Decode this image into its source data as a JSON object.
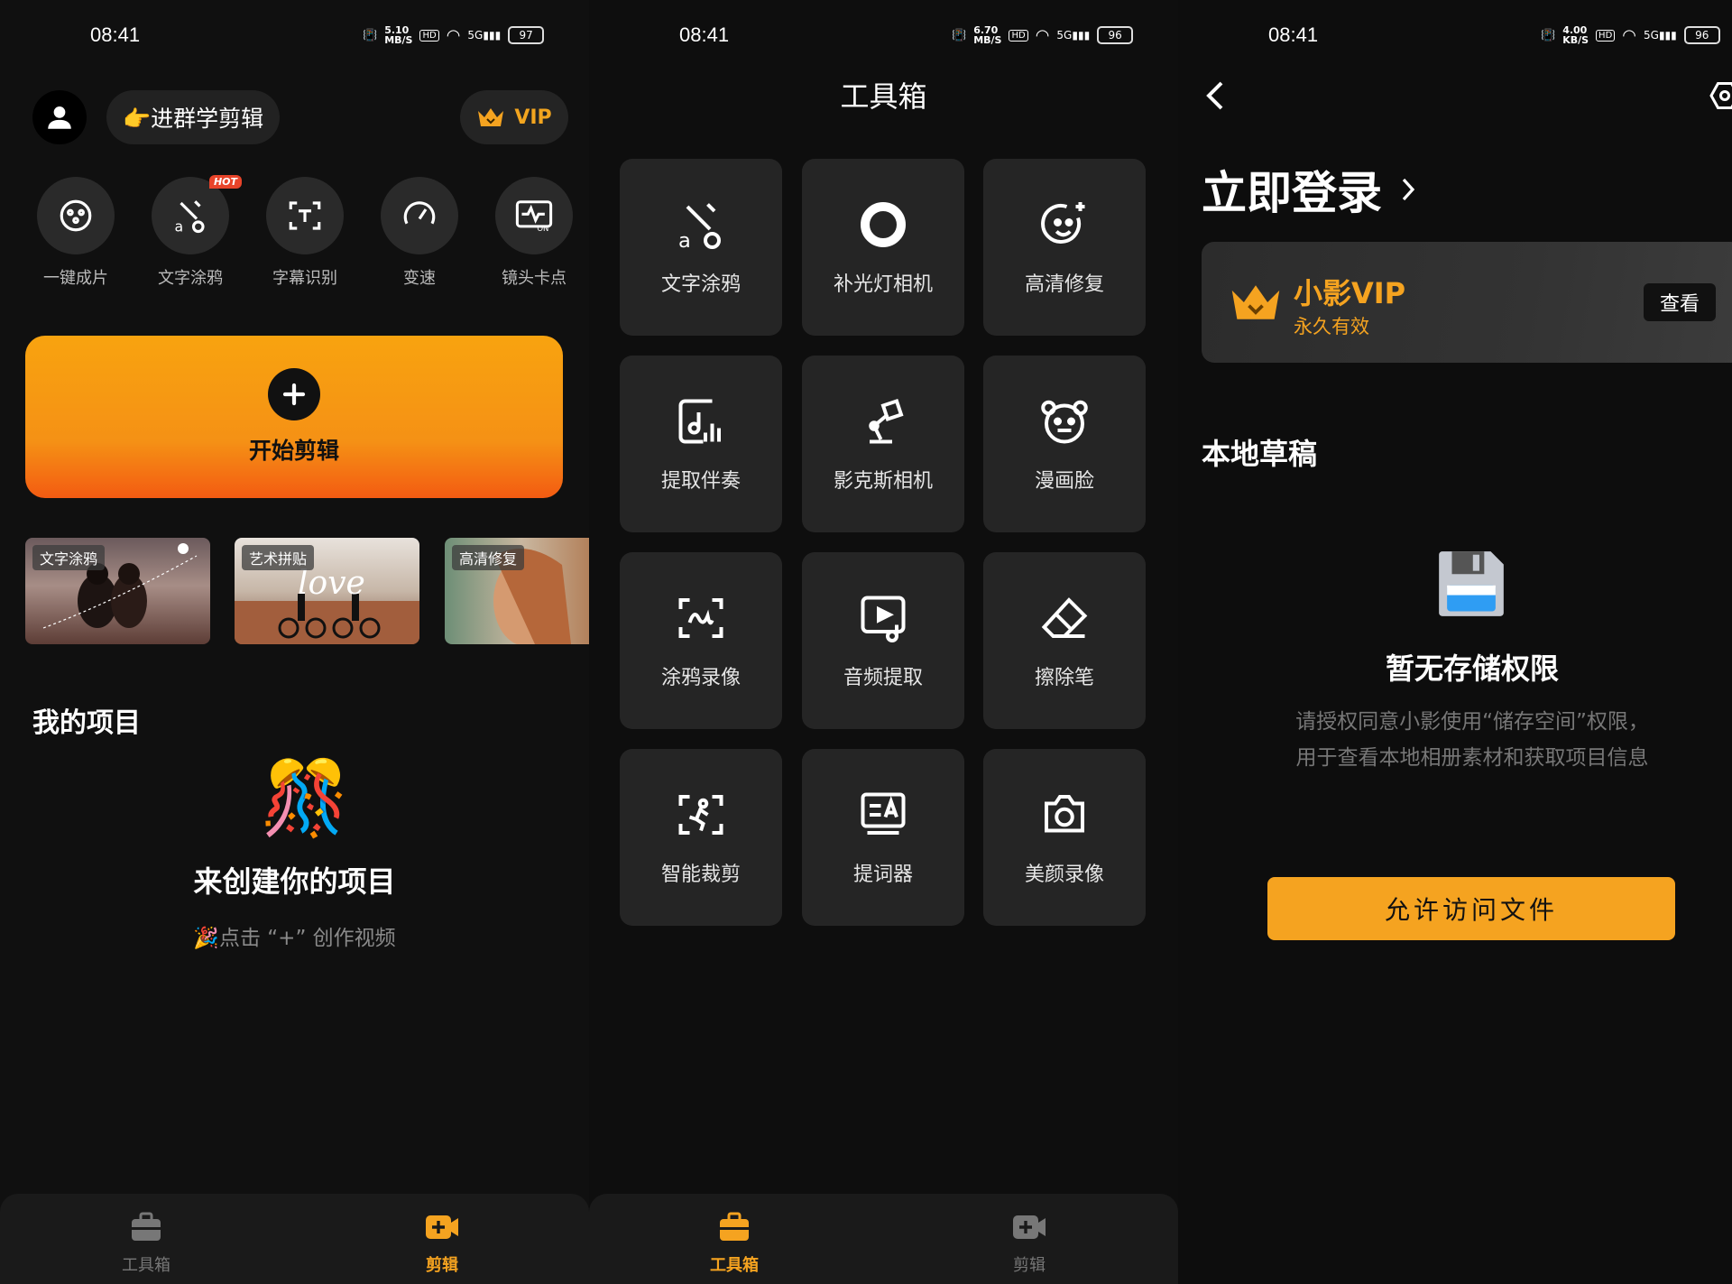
{
  "status": [
    {
      "time": "08:41",
      "speed_value": "5.10",
      "speed_unit": "MB/S",
      "hd": "HD",
      "signal": "5G",
      "battery": "97"
    },
    {
      "time": "08:41",
      "speed_value": "6.70",
      "speed_unit": "MB/S",
      "hd": "HD",
      "signal": "5G",
      "battery": "96"
    },
    {
      "time": "08:41",
      "speed_value": "4.00",
      "speed_unit": "KB/S",
      "hd": "HD",
      "signal": "5G",
      "battery": "96"
    }
  ],
  "home": {
    "group_button": "👉进群学剪辑",
    "vip_label": "VIP",
    "quick_actions": [
      {
        "label": "一键成片",
        "icon": "film-reel-icon"
      },
      {
        "label": "文字涂鸦",
        "icon": "text-doodle-icon",
        "badge": "HOT"
      },
      {
        "label": "字幕识别",
        "icon": "subtitle-scan-icon"
      },
      {
        "label": "变速",
        "icon": "speedometer-icon"
      },
      {
        "label": "镜头卡点",
        "icon": "beat-sync-icon",
        "badge_small": "ON"
      }
    ],
    "start_label": "开始剪辑",
    "templates": [
      {
        "tag": "文字涂鸦"
      },
      {
        "tag": "艺术拼贴",
        "overlay": "love"
      },
      {
        "tag": "高清修复"
      }
    ],
    "my_projects_title": "我的项目",
    "empty_title": "来创建你的项目",
    "empty_sub": "🎉点击 “+” 创作视频"
  },
  "toolbox": {
    "title": "工具箱",
    "tools": [
      {
        "label": "文字涂鸦",
        "icon": "text-doodle-icon"
      },
      {
        "label": "补光灯相机",
        "icon": "ring-light-icon"
      },
      {
        "label": "高清修复",
        "icon": "face-sparkle-icon"
      },
      {
        "label": "提取伴奏",
        "icon": "music-extract-icon"
      },
      {
        "label": "影克斯相机",
        "icon": "desk-lamp-icon"
      },
      {
        "label": "漫画脸",
        "icon": "cartoon-face-icon"
      },
      {
        "label": "涂鸦录像",
        "icon": "doodle-record-icon"
      },
      {
        "label": "音频提取",
        "icon": "audio-extract-icon"
      },
      {
        "label": "擦除笔",
        "icon": "eraser-icon"
      },
      {
        "label": "智能裁剪",
        "icon": "smart-crop-icon"
      },
      {
        "label": "提词器",
        "icon": "teleprompter-icon"
      },
      {
        "label": "美颜录像",
        "icon": "camera-icon"
      }
    ]
  },
  "tabbar": {
    "toolbox": "工具箱",
    "edit": "剪辑"
  },
  "profile": {
    "login_title": "立即登录",
    "vip_name": "小影VIP",
    "vip_validity": "永久有效",
    "vip_view": "查看",
    "drafts_title": "本地草稿",
    "no_permission_title": "暂无存储权限",
    "no_permission_line1": "请授权同意小影使用“储存空间”权限，",
    "no_permission_line2": "用于查看本地相册素材和获取项目信息",
    "allow_button": "允许访问文件"
  },
  "colors": {
    "accent": "#F5A320",
    "card": "#252525",
    "background": "#101010"
  }
}
